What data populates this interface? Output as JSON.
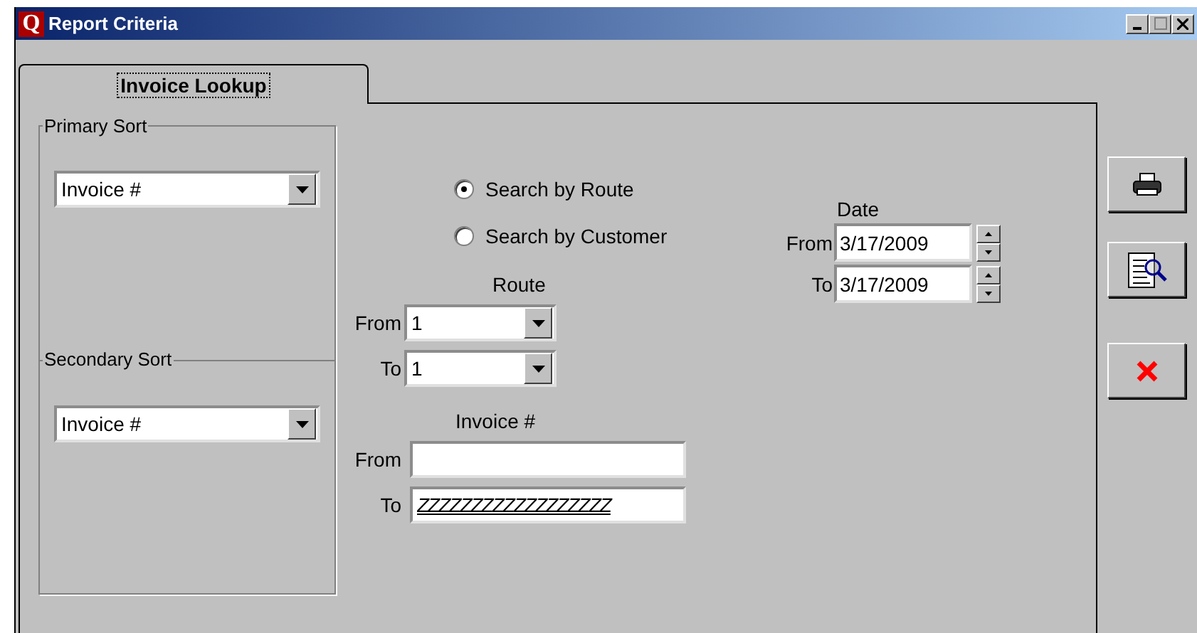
{
  "window": {
    "logo": "Q",
    "title": "Report Criteria"
  },
  "tabs": [
    {
      "label": "Invoice Lookup",
      "selected": true
    }
  ],
  "primary_sort": {
    "label": "Primary Sort",
    "value": "Invoice #"
  },
  "secondary_sort": {
    "label": "Secondary Sort",
    "value": "Invoice #"
  },
  "search_options": [
    {
      "label": "Search by Route",
      "selected": true
    },
    {
      "label": "Search by Customer",
      "selected": false
    }
  ],
  "route": {
    "label": "Route",
    "from_label": "From",
    "from": "1",
    "to_label": "To",
    "to": "1"
  },
  "invoice": {
    "label": "Invoice #",
    "from_label": "From",
    "to_label": "To",
    "to": "ZZZZZZZZZZZZZZZZZZ"
  },
  "date": {
    "label": "Date",
    "from_label": "From",
    "from": "3/17/2009",
    "to_label": "To",
    "to": "3/17/2009"
  }
}
